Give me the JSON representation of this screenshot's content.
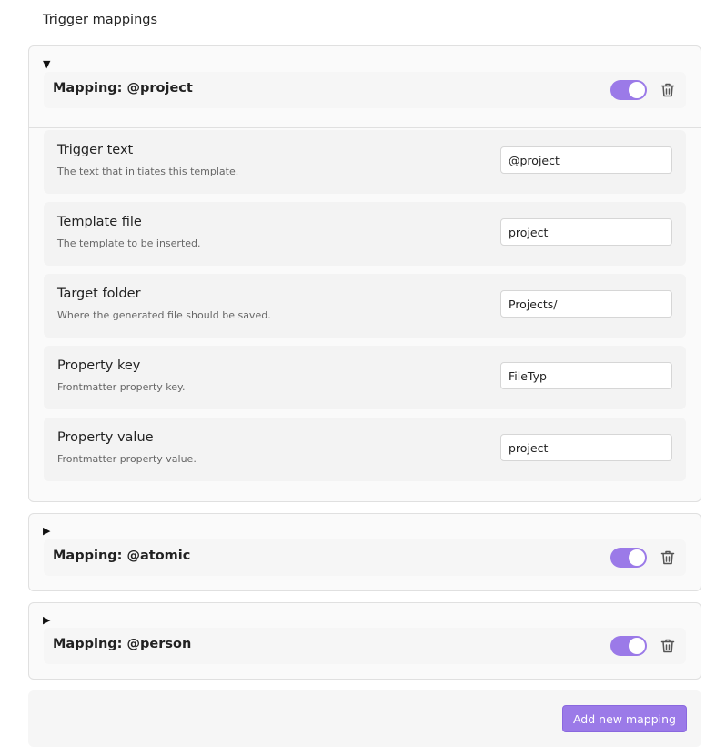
{
  "section_title": "Trigger mappings",
  "accent_color": "#9b7ae8",
  "mappings": [
    {
      "title": "Mapping: @project",
      "expanded": true,
      "enabled": true,
      "settings": [
        {
          "name": "Trigger text",
          "description": "The text that initiates this template.",
          "value": "@project"
        },
        {
          "name": "Template file",
          "description": "The template to be inserted.",
          "value": "project"
        },
        {
          "name": "Target folder",
          "description": "Where the generated file should be saved.",
          "value": "Projects/"
        },
        {
          "name": "Property key",
          "description": "Frontmatter property key.",
          "value": "FileTyp"
        },
        {
          "name": "Property value",
          "description": "Frontmatter property value.",
          "value": "project"
        }
      ]
    },
    {
      "title": "Mapping: @atomic",
      "expanded": false,
      "enabled": true
    },
    {
      "title": "Mapping: @person",
      "expanded": false,
      "enabled": true
    }
  ],
  "icons": {
    "expanded": "▼",
    "collapsed": "▶",
    "delete": "trash-icon"
  },
  "footer": {
    "add_label": "Add new mapping"
  }
}
